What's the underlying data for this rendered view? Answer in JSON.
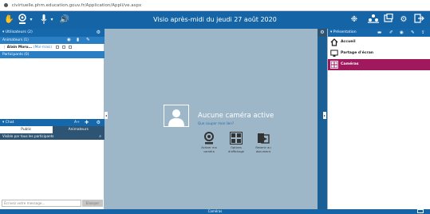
{
  "browser": {
    "url": "civirtuelle.phm.education.gouv.fr/Application/Appli/ve.aspx"
  },
  "topbar": {
    "title": "Visio après-midi du jeudi 27 août 2020",
    "icons_left": [
      "hand-icon",
      "webcam-icon",
      "microphone-icon",
      "speaker-icon"
    ],
    "icons_right": [
      "settings-dots-icon",
      "layout-icon",
      "share-screen-icon",
      "gear-icon",
      "exit-icon"
    ]
  },
  "left": {
    "users_header": "Utilisateurs (2)",
    "animators_label": "Animateurs (1)",
    "animator_name": "Alain Moru...",
    "animator_role": "(Moi-mais)",
    "participants_label": "Participants (0)",
    "chat_header": "Chat",
    "chat_font_label": "A+",
    "tabs": [
      {
        "label": "Public",
        "active": true
      },
      {
        "label": "Animateurs",
        "active": false
      }
    ],
    "visible_label": "Visible par tous les participants",
    "chat_placeholder": "Écrivez votre message...",
    "send_label": "Envoyer"
  },
  "center": {
    "no_camera_title": "Aucune caméra active",
    "why_link": "Que couper mon lien?",
    "actions": [
      {
        "icon": "webcam-icon",
        "label_line1": "Activer ma",
        "label_line2": "caméra"
      },
      {
        "icon": "layout-grid-icon",
        "label_line1": "Options",
        "label_line2": "d'affichage"
      },
      {
        "icon": "document-icon",
        "label_line1": "Revenir au",
        "label_line2": "document"
      }
    ]
  },
  "right": {
    "header": "Présentation",
    "items": [
      {
        "label": "Accueil",
        "icon": "home-icon",
        "selected": false
      },
      {
        "label": "Partage d'écran",
        "icon": "monitor-icon",
        "selected": false
      },
      {
        "label": "Caméras",
        "icon": "cameras-icon",
        "selected": true
      }
    ]
  },
  "bottom": {
    "label": "Caméras"
  },
  "colors": {
    "primary": "#1565a6",
    "selected": "#a0195c",
    "center_bg": "#9db7c9",
    "dark_tab": "#2d5472"
  }
}
